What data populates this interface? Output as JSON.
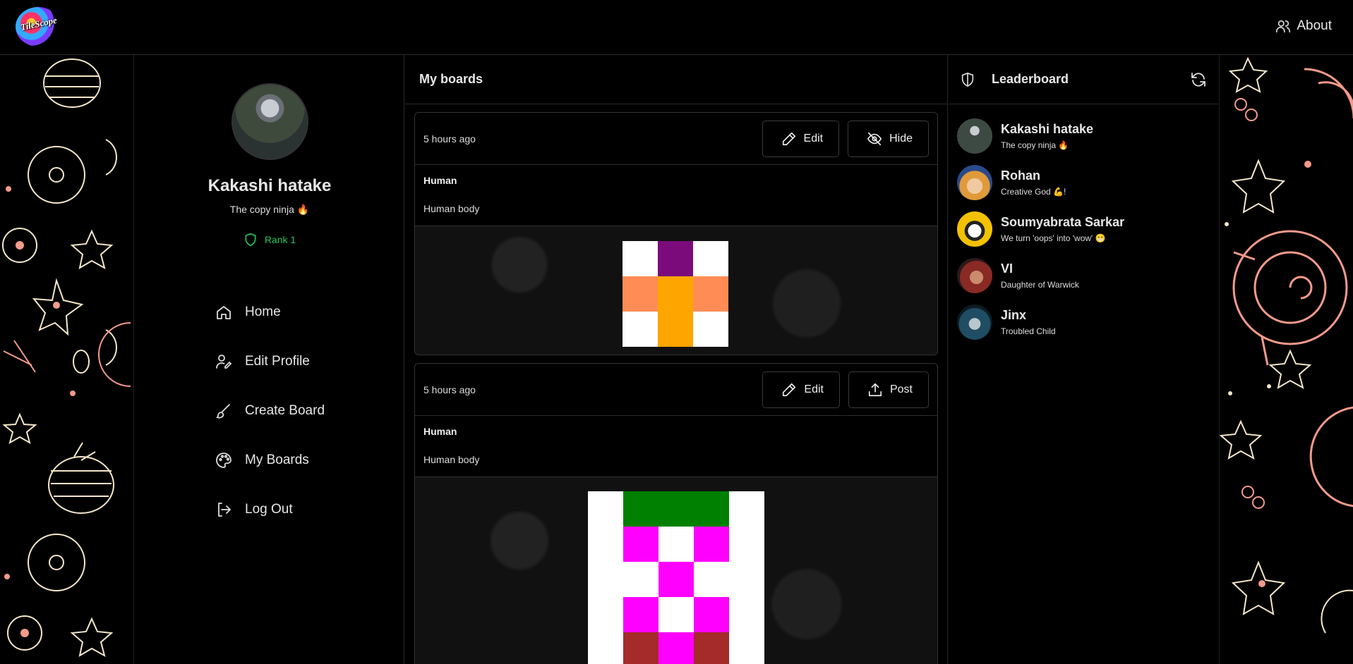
{
  "header": {
    "logo_text": "TileScope",
    "about_label": "About"
  },
  "profile": {
    "name": "Kakashi hatake",
    "bio": "The copy ninja 🔥",
    "rank": "Rank 1"
  },
  "nav": {
    "items": [
      {
        "label": "Home",
        "icon": "home-icon"
      },
      {
        "label": "Edit Profile",
        "icon": "user-edit-icon"
      },
      {
        "label": "Create Board",
        "icon": "brush-icon"
      },
      {
        "label": "My Boards",
        "icon": "palette-icon"
      },
      {
        "label": "Log Out",
        "icon": "logout-icon"
      }
    ]
  },
  "main": {
    "title": "My boards",
    "boards": [
      {
        "time": "5 hours ago",
        "edit_label": "Edit",
        "action_label": "Hide",
        "action_icon": "eye-off-icon",
        "title": "Human",
        "description": "Human body",
        "size": 3,
        "pixels": [
          "#ffffff",
          "#7b0a7b",
          "#ffffff",
          "#ff8c55",
          "#ffa500",
          "#ff8c55",
          "#ffffff",
          "#ffa500",
          "#ffffff"
        ]
      },
      {
        "time": "5 hours ago",
        "edit_label": "Edit",
        "action_label": "Post",
        "action_icon": "upload-icon",
        "title": "Human",
        "description": "Human body",
        "size": 5,
        "pixels": [
          "#ffffff",
          "#008000",
          "#008000",
          "#008000",
          "#ffffff",
          "#ffffff",
          "#ff00ff",
          "#ffffff",
          "#ff00ff",
          "#ffffff",
          "#ffffff",
          "#ffffff",
          "#ff00ff",
          "#ffffff",
          "#ffffff",
          "#ffffff",
          "#ff00ff",
          "#ffffff",
          "#ff00ff",
          "#ffffff",
          "#ffffff",
          "#a52a2a",
          "#ff00ff",
          "#a52a2a",
          "#ffffff"
        ]
      }
    ]
  },
  "leaderboard": {
    "title": "Leaderboard",
    "users": [
      {
        "name": "Kakashi hatake",
        "bio": "The copy ninja 🔥",
        "color": "#3d4a44"
      },
      {
        "name": "Rohan",
        "bio": "Creative God 💪!",
        "color": "#e09a3a"
      },
      {
        "name": "Soumyabrata Sarkar",
        "bio": "We turn 'oops' into 'wow' 😁",
        "color": "#f2c200"
      },
      {
        "name": "VI",
        "bio": "Daughter of Warwick",
        "color": "#8a2a24"
      },
      {
        "name": "Jinx",
        "bio": "Troubled Child",
        "color": "#1f4d63"
      }
    ]
  },
  "colors": {
    "accent_green": "#22c55e",
    "doodle": "#f4a28a"
  }
}
